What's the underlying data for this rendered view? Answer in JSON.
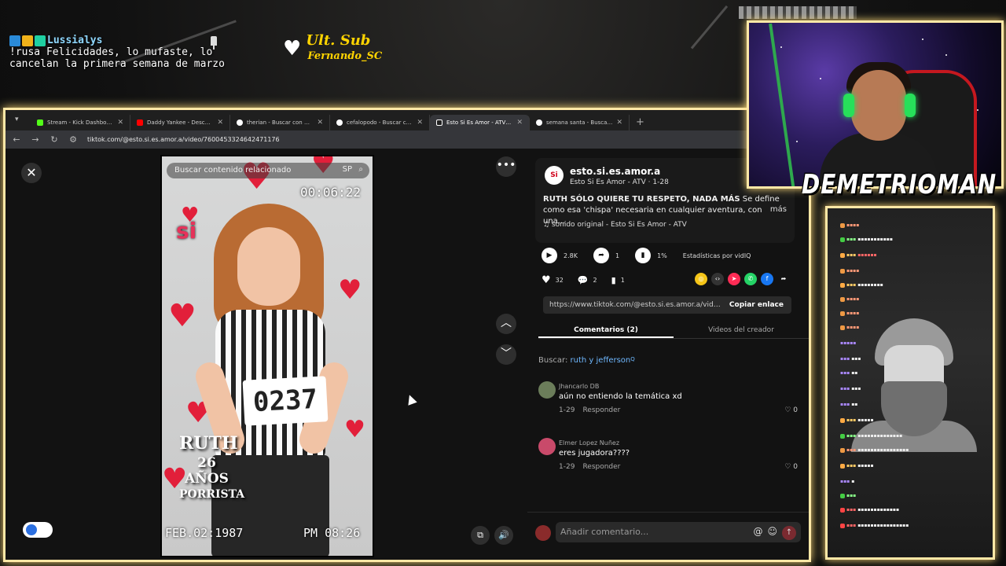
{
  "overlay": {
    "username": "Lussialys",
    "message": "!rusa Felicidades, lo mufaste, lo cancelan la primera semana de marzo",
    "last_sub_title": "Ult. Sub",
    "last_sub_name": "Fernando_SC"
  },
  "browser": {
    "tabs": [
      {
        "label": "Stream - Kick Dashboard",
        "icon_color": "#53fc18",
        "active": false
      },
      {
        "label": "Daddy Yankee - Descontrol - Yo",
        "icon_color": "#ff0000",
        "active": false
      },
      {
        "label": "therian - Buscar con Google",
        "icon_color": "#ffffff",
        "active": false
      },
      {
        "label": "cefalopodo - Buscar con Goog",
        "icon_color": "#ffffff",
        "active": false
      },
      {
        "label": "Esto Si Es Amor - ATV (@es",
        "icon_color": "#ffffff",
        "active": true
      },
      {
        "label": "semana santa - Buscar con Goo",
        "icon_color": "#ffffff",
        "active": false
      }
    ],
    "url": "tiktok.com/@esto.si.es.amor.a/video/7600453324642471176"
  },
  "video": {
    "related_search": "Buscar contenido relacionado",
    "timecode": "00:06:22",
    "sp_label": "SP",
    "logo_text": "si",
    "bib_number": "0237",
    "name": "RUTH",
    "age": "26 AÑOS",
    "role": "PORRISTA",
    "date_stamp": "FEB.02:1987",
    "time_stamp": "PM 08:26"
  },
  "post": {
    "author_handle": "esto.si.es.amor.a",
    "author_sub": "Esto Si Es Amor - ATV · 1-28",
    "avatar_text": "Si",
    "description_bold": "RUTH SÓLO QUIERE TU RESPETO, NADA MÁS",
    "description": " Se define como esa 'chispa' necesaria en cualquier aventura, con una...",
    "more_label": "más",
    "sound": "sonido original - Esto Si Es Amor - ATV",
    "play_count": "2.8K",
    "share_count": "1",
    "stats_pct": "1%",
    "stats_label": "Estadísticas por vidIQ",
    "likes": "32",
    "comments": "2",
    "saves": "1",
    "link": "https://www.tiktok.com/@esto.si.es.amor.a/video/...",
    "copy_label": "Copiar enlace",
    "tab_comments": "Comentarios (2)",
    "tab_creator": "Videos del creador",
    "search_prefix": "Buscar:",
    "search_term": "ruth y jefferson",
    "comment_list": [
      {
        "user": "Jhancarlo DB",
        "text": "aún no entiendo la temática xd",
        "date": "1-29",
        "reply": "Responder",
        "likes": "0",
        "avatar_color": "#6b7d5a"
      },
      {
        "user": "Elmer Lopez Nuñez",
        "text": "eres jugadora????",
        "date": "1-29",
        "reply": "Responder",
        "likes": "0",
        "avatar_color": "#c94a6a"
      }
    ],
    "comment_placeholder": "Añadir comentario..."
  },
  "cam": {
    "streamer_name": "DEMETRIOMAN"
  },
  "colors": {
    "frame_glow": "#ffe8a6",
    "tiktok_red": "#fe2c55",
    "link_blue": "#6fb8ff",
    "sub_gold": "#ffd400"
  }
}
